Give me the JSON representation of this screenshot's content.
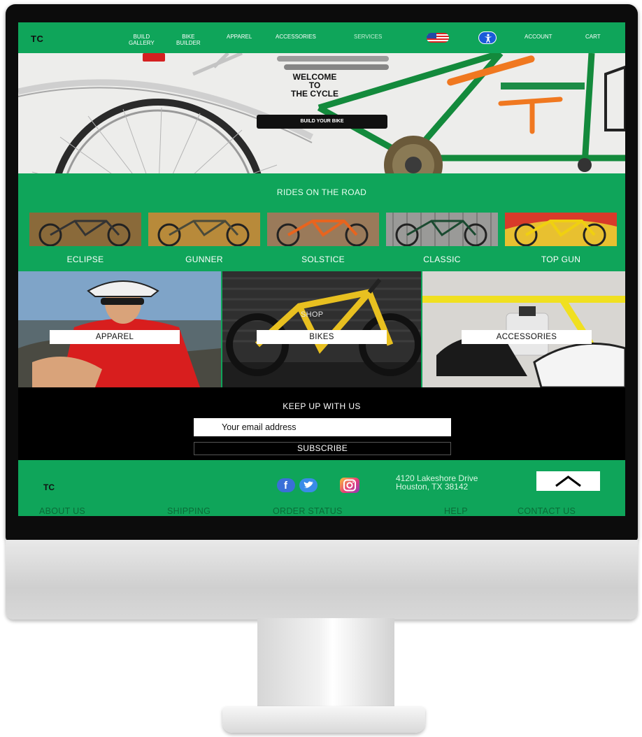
{
  "nav": {
    "logo": "TC",
    "links": [
      {
        "label": "BUILD\nGALLERY"
      },
      {
        "label": "BIKE\nBUILDER"
      },
      {
        "label": "APPAREL"
      },
      {
        "label": "ACCESSORIES"
      },
      {
        "label": "SERVICES"
      },
      {
        "label": "ACCOUNT"
      },
      {
        "label": "CART"
      }
    ],
    "flag_icon": "us-flag-icon",
    "accessibility_icon": "accessibility-icon"
  },
  "hero": {
    "title_lines": [
      "WELCOME",
      "TO",
      "THE CYCLE"
    ],
    "button_label": "BUILD YOUR BIKE"
  },
  "rides": {
    "heading": "RIDES ON THE ROAD",
    "items": [
      {
        "name": "ECLIPSE"
      },
      {
        "name": "GUNNER"
      },
      {
        "name": "SOLSTICE"
      },
      {
        "name": "CLASSIC"
      },
      {
        "name": "TOP GUN"
      }
    ]
  },
  "categories": {
    "apparel": "APPAREL",
    "bikes": "BIKES",
    "accessories": "ACCESSORIES",
    "shop_label": "SHOP"
  },
  "newsletter": {
    "heading": "KEEP UP WITH US",
    "email_placeholder": "Your email address",
    "subscribe_label": "SUBSCRIBE"
  },
  "footer": {
    "logo": "TC",
    "social_icons": [
      "facebook-icon",
      "twitter-icon",
      "instagram-icon"
    ],
    "address_lines": [
      "4120 Lakeshore Drive",
      "Houston, TX 38142"
    ],
    "links": [
      "ABOUT US",
      "SHIPPING",
      "ORDER STATUS",
      "HELP",
      "CONTACT US"
    ]
  },
  "colors": {
    "brand_green": "#0fa55a",
    "dark": "#000000"
  }
}
